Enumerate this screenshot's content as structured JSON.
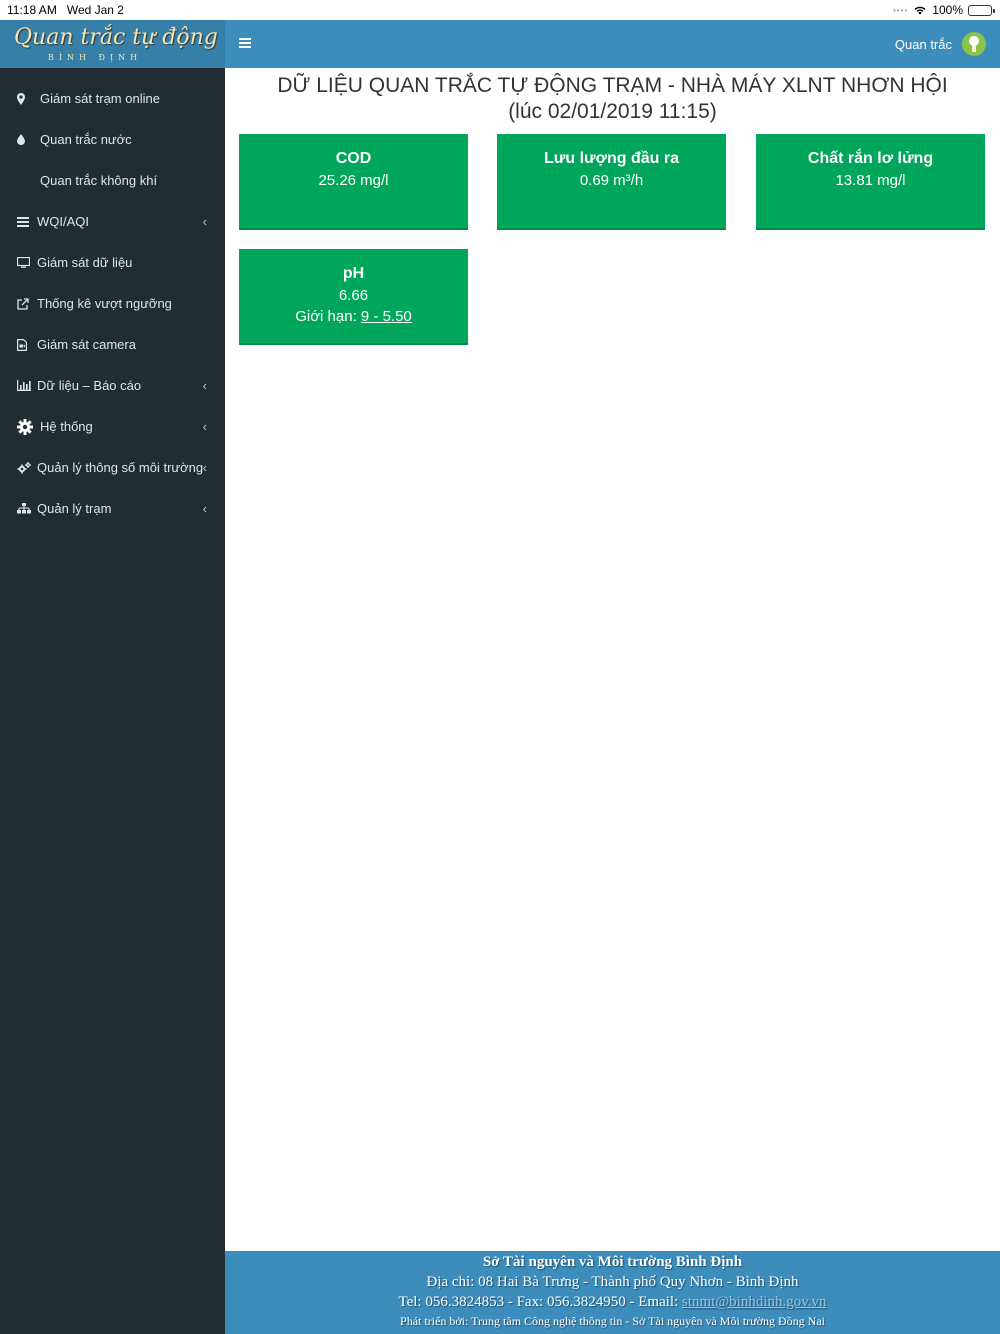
{
  "status_bar": {
    "time": "11:18 AM",
    "date": "Wed Jan 2",
    "battery": "100%"
  },
  "logo": {
    "line1": "Quan trắc tự động",
    "line2": "BÌNH ĐỊNH"
  },
  "sidebar": {
    "items": [
      {
        "label": "Giám sát trạm online",
        "icon": "map-marker-icon",
        "chevron": false
      },
      {
        "label": "Quan trắc nước",
        "icon": "water-drop-icon",
        "chevron": false
      },
      {
        "label": "Quan trắc không khí",
        "icon": "",
        "chevron": false
      },
      {
        "label": "WQI/AQI",
        "icon": "list-icon",
        "chevron": true
      },
      {
        "label": "Giám sát dữ liệu",
        "icon": "monitor-icon",
        "chevron": false
      },
      {
        "label": "Thống kê vượt ngưỡng",
        "icon": "external-link-icon",
        "chevron": false
      },
      {
        "label": "Giám sát camera",
        "icon": "file-video-icon",
        "chevron": false
      },
      {
        "label": "Dữ liệu – Báo cáo",
        "icon": "bar-chart-icon",
        "chevron": true
      },
      {
        "label": "Hệ thống",
        "icon": "gear-icon",
        "chevron": true
      },
      {
        "label": "Quản lý thông số môi trường",
        "icon": "gears-icon",
        "chevron": true
      },
      {
        "label": "Quản lý trạm",
        "icon": "sitemap-icon",
        "chevron": true
      }
    ]
  },
  "header": {
    "user_label": "Quan trắc",
    "menu_icon": "hamburger-icon",
    "avatar_icon": "user-avatar-icon"
  },
  "main": {
    "title_line1": "DỮ LIỆU QUAN TRẮC TỰ ĐỘNG TRẠM - NHÀ MÁY XLNT NHƠN HỘI",
    "title_line2": "(lúc 02/01/2019 11:15)",
    "cards": [
      {
        "name": "COD",
        "value": "25.26 mg/l"
      },
      {
        "name": "Lưu lượng đầu ra",
        "value": "0.69 m³/h"
      },
      {
        "name": "Chất rắn lơ lửng",
        "value": "13.81 mg/l"
      },
      {
        "name": "pH",
        "value": "6.66",
        "limit_label": "Giới hạn:",
        "limit_range": "9 - 5.50"
      }
    ],
    "card_color": "#00a65a"
  },
  "footer": {
    "org": "Sở Tài nguyên và Môi trường Bình Định",
    "address": "Địa chỉ: 08 Hai Bà Trưng - Thành phố Quy Nhơn - Bình Định",
    "contact_prefix": "Tel: 056.3824853 - Fax: 056.3824950 - Email: ",
    "email": "stnmt@binhdinh.gov.vn",
    "developer": "Phát triển bởi: Trung tâm Công nghệ thông tin - Sở Tài nguyên và Môi trường Đồng Nai"
  },
  "colors": {
    "header": "#3c8dbc",
    "logo_bg": "#367fa9",
    "sidebar": "#222d32",
    "card": "#00a65a"
  }
}
